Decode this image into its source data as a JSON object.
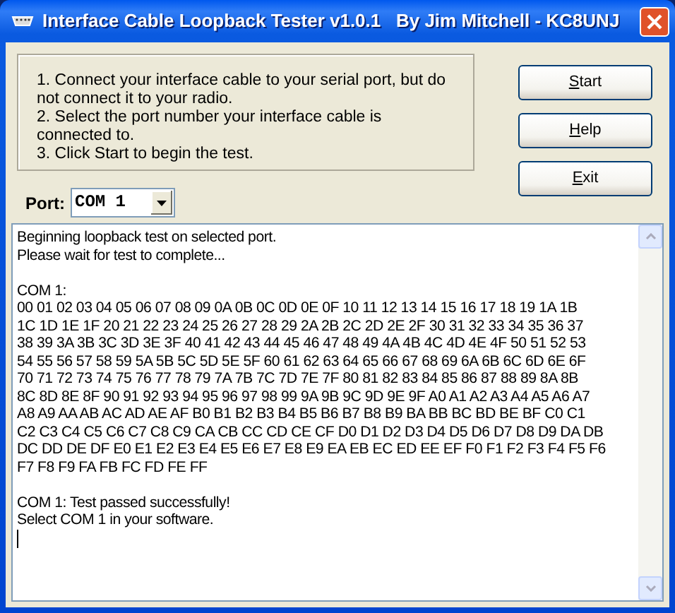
{
  "window": {
    "title": "Interface Cable Loopback Tester v1.0.1   By Jim Mitchell - KC8UNJ"
  },
  "instructions": [
    "1. Connect your interface cable to your serial port, but do not connect it to your radio.",
    "2. Select the port number your interface cable is connected to.",
    "3. Click Start to begin the test."
  ],
  "buttons": [
    "Start",
    "Help",
    "Exit"
  ],
  "port": {
    "label": "Port:",
    "value": "COM 1"
  },
  "log": [
    [
      "Beginning loopback test on selected port.",
      "Please wait for test to complete..."
    ],
    [
      "COM 1:",
      "00 01 02 03 04 05 06 07 08 09 0A 0B 0C 0D 0E 0F 10 11 12 13 14 15 16 17 18 19 1A 1B",
      "1C 1D 1E 1F 20 21 22 23 24 25 26 27 28 29 2A 2B 2C 2D 2E 2F 30 31 32 33 34 35 36 37",
      "38 39 3A 3B 3C 3D 3E 3F 40 41 42 43 44 45 46 47 48 49 4A 4B 4C 4D 4E 4F 50 51 52 53",
      "54 55 56 57 58 59 5A 5B 5C 5D 5E 5F 60 61 62 63 64 65 66 67 68 69 6A 6B 6C 6D 6E 6F",
      "70 71 72 73 74 75 76 77 78 79 7A 7B 7C 7D 7E 7F 80 81 82 83 84 85 86 87 88 89 8A 8B",
      "8C 8D 8E 8F 90 91 92 93 94 95 96 97 98 99 9A 9B 9C 9D 9E 9F A0 A1 A2 A3 A4 A5 A6 A7",
      "A8 A9 AA AB AC AD AE AF B0 B1 B2 B3 B4 B5 B6 B7 B8 B9 BA BB BC BD BE BF C0 C1",
      "C2 C3 C4 C5 C6 C7 C8 C9 CA CB CC CD CE CF D0 D1 D2 D3 D4 D5 D6 D7 D8 D9 DA DB",
      "DC DD DE DF E0 E1 E2 E3 E4 E5 E6 E7 E8 E9 EA EB EC ED EE EF F0 F1 F2 F3 F4 F5 F6",
      "F7 F8 F9 FA FB FC FD FE FF"
    ],
    [
      "COM 1: Test passed successfully!",
      "Select COM 1 in your software."
    ]
  ]
}
